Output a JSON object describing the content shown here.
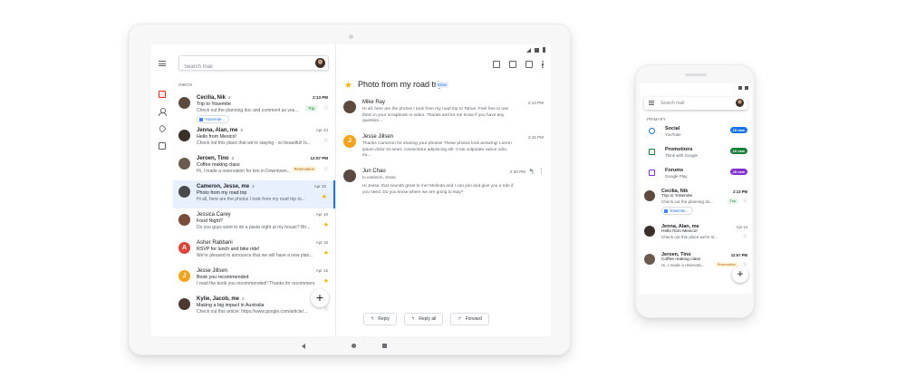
{
  "tablet": {
    "search": {
      "placeholder": "Search mail"
    },
    "section_label": "INBOX",
    "threads": [
      {
        "sender": "Cecilia, Nik",
        "count": "2",
        "subject": "Trip to Yosemite",
        "snippet": "Check out the planning doc and comment as you...",
        "date": "2:13 PM",
        "badge": "Trip",
        "chip": "Yosemite...",
        "avatar_color": "#5d4a3f",
        "avatar_letter": "",
        "starred": false
      },
      {
        "sender": "Jenna, Alan, me",
        "count": "5",
        "subject": "Hello from Mexico!",
        "snippet": "Check out this place that we're staying - so beautiful! Is...",
        "date": "Apr 24",
        "badge": "",
        "chip": "",
        "avatar_color": "#3b2f2a",
        "avatar_letter": "",
        "starred": false
      },
      {
        "sender": "Jeroen, Tino",
        "count": "3",
        "subject": "Coffee making class",
        "snippet": "Hi, I made a reservation for two in Downtown...",
        "date": "12:57 PM",
        "badge": "Reservation",
        "chip": "",
        "avatar_color": "#6b5a4e",
        "avatar_letter": "",
        "starred": false
      },
      {
        "sender": "Cameron, Jesse, me",
        "count": "3",
        "subject": "Photo from my road trip",
        "snippet": "Hi all, here are the photos I took from my road trip to...",
        "date": "Apr 25",
        "badge": "",
        "chip": "",
        "avatar_color": "#4a4a4a",
        "avatar_letter": "",
        "starred": true
      },
      {
        "sender": "Jessica Carey",
        "count": "",
        "subject": "Food Night?",
        "snippet": "Do you guys want to do a pasta night at my house? Bri...",
        "date": "Apr 16",
        "badge": "",
        "chip": "",
        "avatar_color": "#7a4a3a",
        "avatar_letter": "",
        "starred": true
      },
      {
        "sender": "Asher Rabbani",
        "count": "",
        "subject": "RSVP for lunch and bike ride!",
        "snippet": "We're pleased to announce that we will have a new plan...",
        "date": "Apr 15",
        "badge": "",
        "chip": "",
        "avatar_color": "#db4437",
        "avatar_letter": "A",
        "starred": true
      },
      {
        "sender": "Jesse Jillsen",
        "count": "",
        "subject": "Book you recommended",
        "snippet": "I read the book you recommended!! Thanks for recommending...",
        "date": "Apr 15",
        "badge": "",
        "chip": "",
        "avatar_color": "#f4a41c",
        "avatar_letter": "J",
        "starred": true
      },
      {
        "sender": "Kylie, Jacob, me",
        "count": "3",
        "subject": "Making a big impact in Australia",
        "snippet": "Check out this article: https://www.google.com/article/...",
        "date": "Apr 9",
        "badge": "",
        "chip": "",
        "avatar_color": "#4a3a32",
        "avatar_letter": "",
        "starred": false
      }
    ],
    "reading": {
      "title": "Photo from my road trip",
      "label": "Inbox",
      "messages": [
        {
          "from": "Mike Ray",
          "time": "2:13 PM",
          "body": "Hi all, here are the photos I took from my road trip to Tahoe. Feel free to use them in your scrapbook or video. Thanks and let me know if you have any question...",
          "avatar_color": "#5d4a3f",
          "avatar_letter": ""
        },
        {
          "from": "Jesse Jillsen",
          "time": "2:15 PM",
          "body": "Thanks Cameron for sharing your photos! These photos look amazing! Lorem ipsum dolor sit amet, consectetur adipiscing elit. Cras vulputate varius odio, eu...",
          "avatar_color": "#f4a41c",
          "avatar_letter": "J"
        },
        {
          "from": "Jun Chao",
          "to": "to cameron, Jesse",
          "time": "2:30 PM",
          "body": "Hi Jesse, that sounds great to me! Melinda and I can join and give you a ride if you need. Do you know where we are going to stay?",
          "avatar_color": "#5a4a42",
          "avatar_letter": ""
        }
      ],
      "buttons": {
        "reply": "Reply",
        "reply_all": "Reply all",
        "forward": "Forward"
      }
    }
  },
  "phone": {
    "search": {
      "placeholder": "Search mail"
    },
    "section_label": "PRIMARY",
    "categories": [
      {
        "name": "Social",
        "sub": "YouTube",
        "pill": "10 new",
        "pill_color": "#1a73e8",
        "icon_color": "#1a73e8"
      },
      {
        "name": "Promotions",
        "sub": "Think with Google",
        "pill": "10 new",
        "pill_color": "#188038",
        "icon_color": "#188038"
      },
      {
        "name": "Forums",
        "sub": "Google Play",
        "pill": "25 new",
        "pill_color": "#8430ce",
        "icon_color": "#8430ce"
      }
    ],
    "threads": [
      {
        "sender": "Cecilia, Nik",
        "subject": "Trip to Yosemite",
        "snippet": "Check out the planning do...",
        "date": "2:13 PM",
        "badge": "Trip",
        "chip": "Yosemite...",
        "avatar_color": "#5d4a3f",
        "starred": false
      },
      {
        "sender": "Jenna, Alan, me",
        "subject": "Hello from Mexico!",
        "snippet": "Check out this place we're st...",
        "date": "Apr 14",
        "badge": "",
        "chip": "",
        "avatar_color": "#3b2f2a",
        "starred": false
      },
      {
        "sender": "Jeroen, Tino",
        "subject": "Coffee making class",
        "snippet": "Hi, I made a reservati...",
        "date": "12:57 PM",
        "badge": "Reservation",
        "chip": "",
        "avatar_color": "#6b5a4e",
        "starred": false
      }
    ]
  },
  "colors": {
    "accent": "#1a73e8",
    "star": "#f4b400",
    "selected_row": "#e8f0fe",
    "inbox_red": "#d93025"
  }
}
